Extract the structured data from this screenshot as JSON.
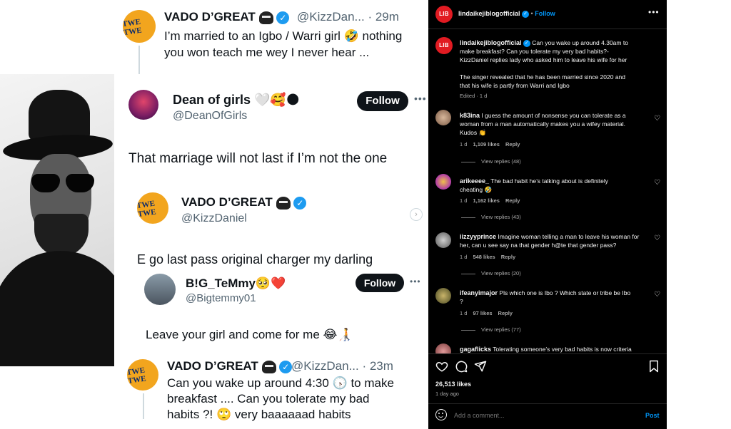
{
  "tweet_top": {
    "name": "VADO D’GREAT",
    "handle_time": "@KizzDan... · 29m",
    "line1": "I’m married to an Igbo / Warri girl 🤣 nothing",
    "line2": "you won teach me wey I never hear ..."
  },
  "tweet_dean": {
    "name": "Dean of girls 🤍🥰🌑",
    "handle": "@DeanOfGirls",
    "follow": "Follow",
    "text": "That  marriage will not last if I’m not the one"
  },
  "tweet_vado2": {
    "name": "VADO D’GREAT",
    "handle": "@KizzDaniel",
    "text": "E go last pass original charger my darling"
  },
  "tweet_temmy": {
    "name": "B!G_TeMmy🥺❤️",
    "handle": "@Bigtemmy01",
    "follow": "Follow",
    "text": "Leave your girl and come for me 😂🧑‍🦯"
  },
  "tweet_vado3": {
    "name": "VADO D’GREAT",
    "handle_time": "@KizzDan... · 23m",
    "line1": "Can you wake up around 4:30 🕟  to make",
    "line2": "breakfast .... Can you tolerate my bad",
    "line3": "habits ?! 🙄 very baaaaaad habits"
  },
  "avatar_text": "TWE TWE",
  "ig": {
    "logo": "LIB",
    "account": "lindaikejiblogofficial",
    "follow": "Follow",
    "caption_user": "lindaikejiblogofficial",
    "caption_line1": "Can you wake up around 4.30am to",
    "caption_line2": "make breakfast? Can you tolerate my very bad habits?-",
    "caption_line3": "KizzDaniel replies lady who asked him to leave his wife for her",
    "caption_line4": "The singer revealed that he has been married since 2020 and",
    "caption_line5": "that his wife is partly from Warri and Igbo",
    "edited": "Edited · 1 d",
    "comments": [
      {
        "user": "k83ina",
        "line1": "I guess the amount of nonsense you can tolerate as a",
        "line2": "woman from a man automatically makes you a wifey material.",
        "line3": "Kudos 👏",
        "age": "1 d",
        "likes": "1,109 likes",
        "reply": "Reply",
        "view_replies": "View replies (48)"
      },
      {
        "user": "arikeeee_",
        "line1": "The bad habit he’s talking about is definitely",
        "line2": "cheating 🤣",
        "line3": "",
        "age": "1 d",
        "likes": "1,162 likes",
        "reply": "Reply",
        "view_replies": "View replies (43)"
      },
      {
        "user": "iizzyyprince",
        "line1": "Imagine woman telling a man to leave his woman for",
        "line2": "her, can u see say na that gender h@te that gender pass?",
        "line3": "",
        "age": "1 d",
        "likes": "548 likes",
        "reply": "Reply",
        "view_replies": "View replies (20)"
      },
      {
        "user": "ifeanyimajor",
        "line1": "Pls which one is Ibo ? Which state or tribe be Ibo",
        "line2": "?",
        "line3": "",
        "age": "1 d",
        "likes": "97 likes",
        "reply": "Reply",
        "view_replies": "View replies (77)"
      }
    ],
    "partial_comment_user": "gagaflicks",
    "partial_comment_text": "Tolerating someone’s very bad habits is now criteria",
    "likes_count": "26,513 likes",
    "post_age": "1 day ago",
    "add_comment_placeholder": "Add a comment...",
    "post_label": "Post",
    "colors": {
      "accent": "#0095f6",
      "lib_red": "#e11b22"
    }
  }
}
